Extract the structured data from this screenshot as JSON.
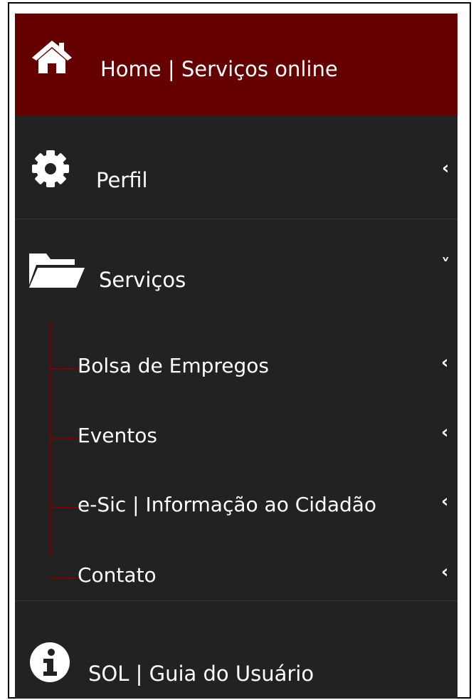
{
  "menu": {
    "home": {
      "label": "Home | Serviços online",
      "icon": "home-icon"
    },
    "perfil": {
      "label": "Perfil",
      "icon": "gear-icon",
      "chevron": "‹"
    },
    "servicos": {
      "label": "Serviços",
      "icon": "folder-open-icon",
      "chevron": "˅",
      "children": [
        {
          "label": "Bolsa de Empregos",
          "chevron": "‹"
        },
        {
          "label": "Eventos",
          "chevron": "‹"
        },
        {
          "label": "e-Sic | Informação ao Cidadão",
          "chevron": "‹"
        },
        {
          "label": "Contato",
          "chevron": "‹"
        }
      ]
    },
    "sol": {
      "label": "SOL | Guia do Usuário",
      "icon": "info-icon"
    }
  },
  "colors": {
    "sidebar_bg": "#222222",
    "home_bg": "#650000",
    "tree_line": "#7a0000",
    "text": "#ffffff"
  }
}
